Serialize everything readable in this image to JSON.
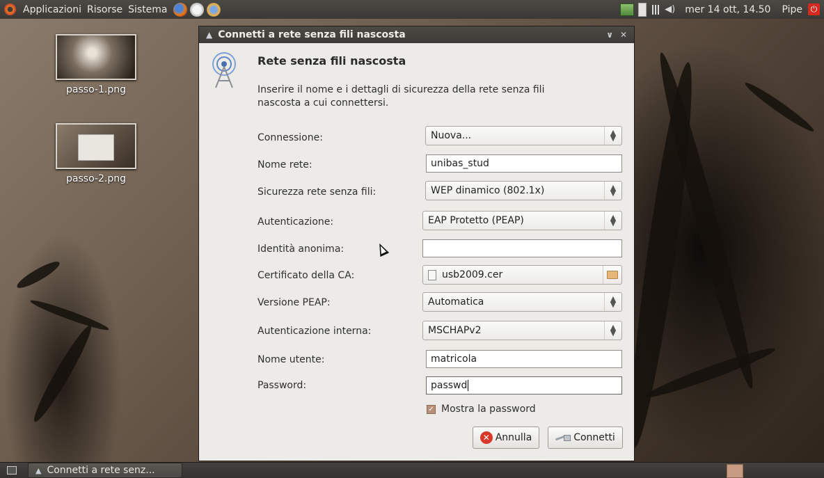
{
  "top_panel": {
    "menus": [
      "Applicazioni",
      "Risorse",
      "Sistema"
    ],
    "clock": "mer 14 ott, 14.50",
    "user": "Pipe",
    "tray_icons": [
      "update-icon",
      "battery-icon",
      "signal-icon",
      "volume-icon"
    ]
  },
  "desktop": {
    "icons": [
      {
        "label": "passo-1.png"
      },
      {
        "label": "passo-2.png"
      }
    ]
  },
  "dialog": {
    "title": "Connetti a rete senza fili nascosta",
    "heading": "Rete senza fili nascosta",
    "description": "Inserire il nome e i dettagli di sicurezza della rete senza fili nascosta a cui connettersi.",
    "fields": {
      "connection": {
        "label": "Connessione:",
        "value": "Nuova..."
      },
      "network_name": {
        "label": "Nome rete:",
        "value": "unibas_stud"
      },
      "security": {
        "label": "Sicurezza rete senza fili:",
        "value": "WEP dinamico (802.1x)"
      },
      "authentication": {
        "label": "Autenticazione:",
        "value": "EAP Protetto (PEAP)"
      },
      "anonymous_identity": {
        "label": "Identità anonima:",
        "value": ""
      },
      "ca_certificate": {
        "label": "Certificato della CA:",
        "value": "usb2009.cer"
      },
      "peap_version": {
        "label": "Versione PEAP:",
        "value": "Automatica"
      },
      "inner_auth": {
        "label": "Autenticazione interna:",
        "value": "MSCHAPv2"
      },
      "username": {
        "label": "Nome utente:",
        "value": "matricola"
      },
      "password": {
        "label": "Password:",
        "value": "passwd"
      }
    },
    "show_password": {
      "label": "Mostra la password",
      "checked": true
    },
    "buttons": {
      "cancel": "Annulla",
      "connect": "Connetti"
    }
  },
  "bottom_panel": {
    "task_label": "Connetti a rete senz..."
  },
  "colors": {
    "panel": "#3c3b37",
    "dialog_bg": "#edebe7",
    "cancel_red": "#d7382a",
    "checkbox": "#b8907a"
  }
}
